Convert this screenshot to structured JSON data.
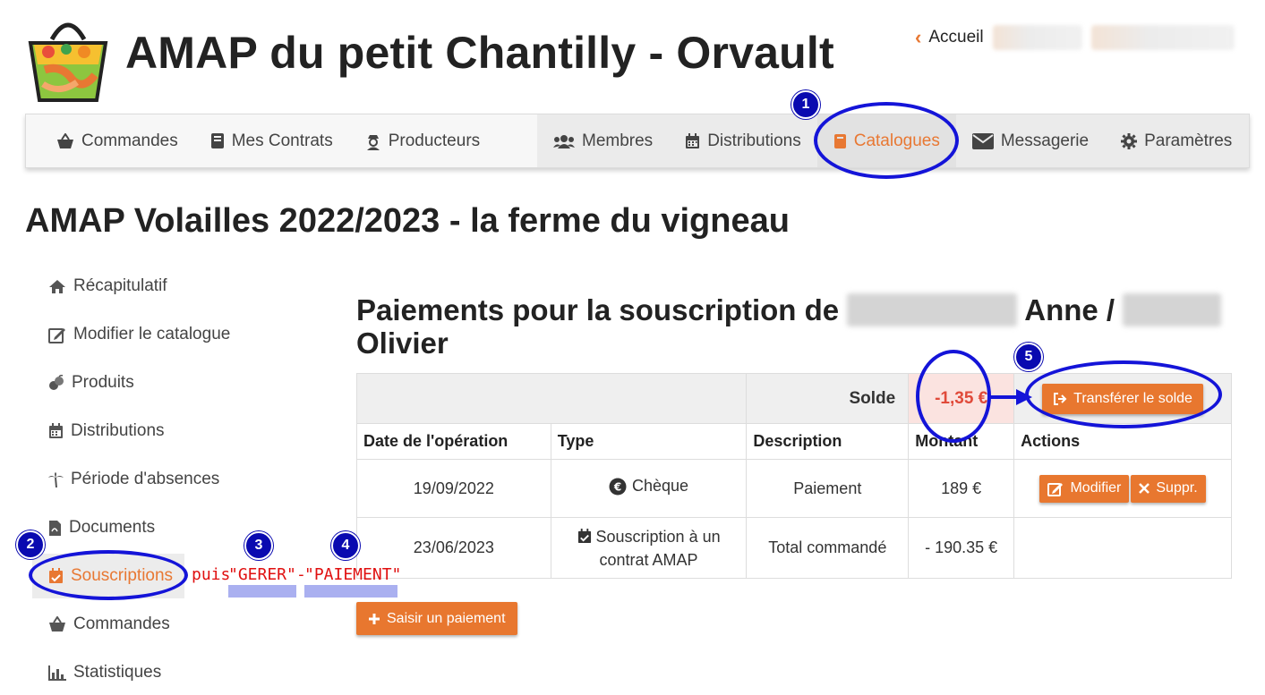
{
  "header": {
    "app_title": "AMAP du petit Chantilly - Orvault",
    "home_link": "Accueil"
  },
  "nav": {
    "left": [
      {
        "label": "Commandes",
        "icon": "basket-icon"
      },
      {
        "label": "Mes Contrats",
        "icon": "book-icon"
      },
      {
        "label": "Producteurs",
        "icon": "farmer-icon"
      }
    ],
    "right": [
      {
        "label": "Membres",
        "icon": "users-icon"
      },
      {
        "label": "Distributions",
        "icon": "calendar-icon"
      },
      {
        "label": "Catalogues",
        "icon": "catalog-icon",
        "active": true
      },
      {
        "label": "Messagerie",
        "icon": "envelope-icon"
      },
      {
        "label": "Paramètres",
        "icon": "gear-icon"
      }
    ]
  },
  "page_title": "AMAP Volailles 2022/2023 - la ferme du vigneau",
  "sidebar": {
    "items": [
      {
        "label": "Récapitulatif",
        "icon": "home-icon"
      },
      {
        "label": "Modifier le catalogue",
        "icon": "edit-icon"
      },
      {
        "label": "Produits",
        "icon": "produce-icon"
      },
      {
        "label": "Distributions",
        "icon": "calendar-icon"
      },
      {
        "label": "Période d'absences",
        "icon": "palm-icon"
      },
      {
        "label": "Documents",
        "icon": "pdf-icon"
      },
      {
        "label": "Souscriptions",
        "icon": "calendar-check-icon",
        "active": true
      },
      {
        "label": "Commandes",
        "icon": "basket-icon"
      },
      {
        "label": "Statistiques",
        "icon": "chart-icon"
      }
    ]
  },
  "annotations": {
    "puis": "puis",
    "gerer": "\"GERER\"",
    "dash": "-",
    "paiement": "\"PAIEMENT\"",
    "badges": [
      "1",
      "2",
      "3",
      "4",
      "5"
    ]
  },
  "main": {
    "title_prefix": "Paiements pour la souscription de",
    "title_name_1": "Anne /",
    "title_name_2": "Olivier",
    "solde_label": "Solde",
    "solde_value": "-1,35 €",
    "transfer_button": "Transférer le solde",
    "columns": [
      "Date de l'opération",
      "Type",
      "Description",
      "Montant",
      "Actions"
    ],
    "rows": [
      {
        "date": "19/09/2022",
        "type": "Chèque",
        "type_icon": "euro-circle-icon",
        "description": "Paiement",
        "amount": "189 €",
        "edit": "Modifier",
        "delete": "Suppr."
      },
      {
        "date": "23/06/2023",
        "type_line1": "Souscription à un",
        "type_line2": "contrat AMAP",
        "type_icon": "calendar-check-icon",
        "description": "Total commandé",
        "amount": "- 190.35 €"
      }
    ],
    "add_payment_button": "Saisir un paiement"
  },
  "colors": {
    "accent": "#e8772f",
    "annotation_blue": "#1414d8",
    "annotation_red": "#e01010",
    "negative_bg": "#fbe3e0"
  }
}
